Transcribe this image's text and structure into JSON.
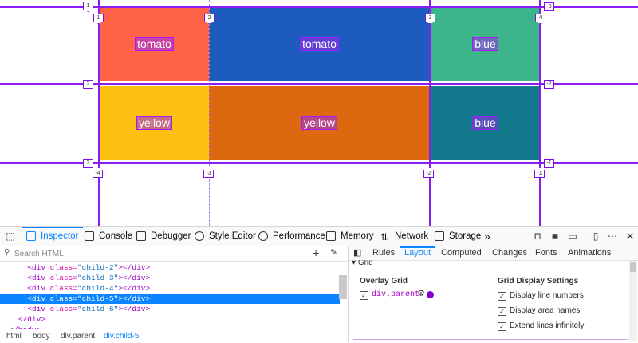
{
  "grid": {
    "cells": [
      {
        "label": "tomato",
        "color": "#ff6347"
      },
      {
        "label": "tomato",
        "color": "#1d5bbf"
      },
      {
        "label": "blue",
        "color": "#3db58a"
      },
      {
        "label": "yellow",
        "color": "#fdc010"
      },
      {
        "label": "yellow",
        "color": "#dd6810"
      },
      {
        "label": "blue",
        "color": "#127a8c"
      }
    ],
    "col_numbers_top": [
      "1",
      "2",
      "3",
      "4"
    ],
    "row_numbers_left": [
      "1",
      "2",
      "3"
    ],
    "row_numbers_right": [
      "-3",
      "-2",
      "-1"
    ],
    "col_numbers_bottom": [
      "-4",
      "-3",
      "-2",
      "-1"
    ],
    "line_color": "#8c1cf0"
  },
  "toolbar": {
    "tools": [
      "Inspector",
      "Console",
      "Debugger",
      "Style Editor",
      "Performance",
      "Memory",
      "Network",
      "Storage"
    ],
    "more": "»"
  },
  "markup": {
    "search_placeholder": "Search HTML",
    "lines": [
      {
        "indent": "      ",
        "tag_open": "<div ",
        "attr": "class=",
        "val": "\"child-2\"",
        "tag_close": "></div>"
      },
      {
        "indent": "      ",
        "tag_open": "<div ",
        "attr": "class=",
        "val": "\"child-3\"",
        "tag_close": "></div>"
      },
      {
        "indent": "      ",
        "tag_open": "<div ",
        "attr": "class=",
        "val": "\"child-4\"",
        "tag_close": "></div>"
      },
      {
        "indent": "      ",
        "tag_open": "<div ",
        "attr": "class=",
        "val": "\"child-5\"",
        "tag_close": "></div>"
      },
      {
        "indent": "      ",
        "tag_open": "<div ",
        "attr": "class=",
        "val": "\"child-6\"",
        "tag_close": "></div>"
      },
      {
        "indent": "    ",
        "tag_open": "</div>",
        "attr": "",
        "val": "",
        "tag_close": ""
      },
      {
        "indent": "  ",
        "tag_open": "</body>",
        "attr": "",
        "val": "",
        "tag_close": ""
      }
    ],
    "selected_index": 3,
    "breadcrumbs": [
      "html",
      "body",
      "div.parent",
      "div.child-5"
    ]
  },
  "sidebar": {
    "tabs": [
      "Rules",
      "Layout",
      "Computed",
      "Changes",
      "Fonts",
      "Animations"
    ],
    "selected_tab": "Layout",
    "section_title": "Grid",
    "overlay_title": "Overlay Grid",
    "overlay_item": "div.parent",
    "overlay_color": "#8000d7",
    "display_title": "Grid Display Settings",
    "display_options": [
      "Display line numbers",
      "Display area names",
      "Extend lines infinitely"
    ]
  }
}
